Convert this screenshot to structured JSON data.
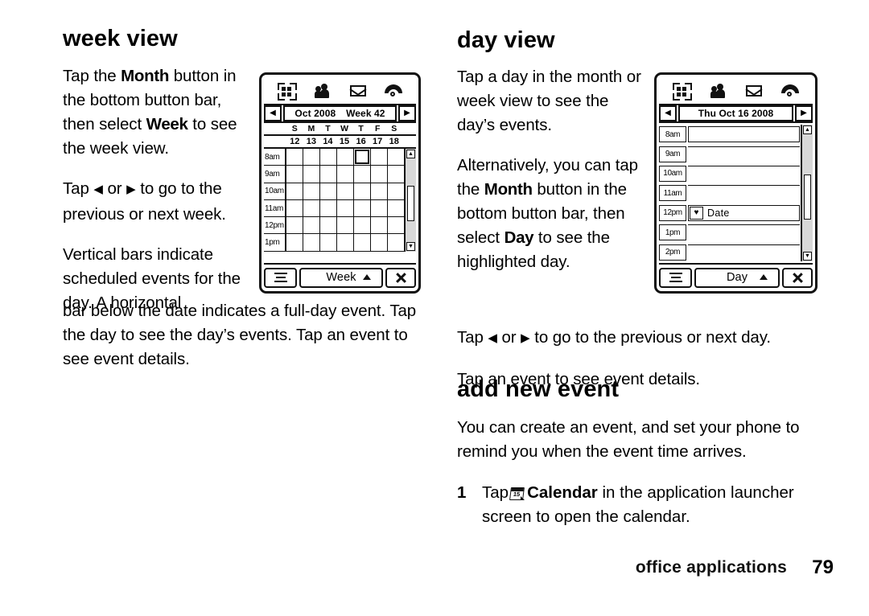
{
  "page": {
    "footer_section": "office applications",
    "page_number": "79"
  },
  "week_section": {
    "heading": "week view",
    "paragraphs": [
      "Tap the <b>Month</b> button in the bottom button bar, then select <b>Week</b> to see the week view.",
      "Tap ◀ or ▶ to go to the previous or next week.",
      "Vertical bars indicate scheduled events for the day. A horizontal"
    ],
    "wide_paragraph": "bar below the date indicates a full-day event. Tap the day to see the day’s events. Tap an event to see event details."
  },
  "day_section": {
    "heading": "day view",
    "paragraphs": [
      "Tap a day in the month or week view to see the day’s events.",
      "Alternatively, you can tap the <b>Month</b> button in the bottom button bar, then select <b>Day</b> to see the highlighted day."
    ],
    "lower_paragraphs": [
      "Tap ◀ or ▶ to go to the previous or next day.",
      "Tap an event to see event details."
    ]
  },
  "add_event_section": {
    "heading": "add new event",
    "intro": "You can create an event, and set your phone to remind you when the event time arrives.",
    "steps": [
      {
        "number": "1",
        "text_before": "Tap",
        "app_name": "Calendar",
        "icon_day": "15",
        "text_after": "in the application launcher screen to open the calendar."
      }
    ]
  },
  "week_phone": {
    "status_icons": [
      "launcher-icon",
      "contacts-icon",
      "message-icon",
      "call-icon"
    ],
    "nav": {
      "prev": "◀",
      "next": "▶",
      "month_year": "Oct 2008",
      "week_label": "Week 42"
    },
    "day_initials": [
      "S",
      "M",
      "T",
      "W",
      "T",
      "F",
      "S"
    ],
    "day_numbers": [
      "12",
      "13",
      "14",
      "15",
      "16",
      "17",
      "18"
    ],
    "time_labels": [
      "8am",
      "9am",
      "10am",
      "11am",
      "12pm",
      "1pm"
    ],
    "selected_cell": {
      "column_index": 4,
      "row_index": 0
    },
    "button_bar": {
      "menu": "menu-icon",
      "mode_label": "Week",
      "close": "close-icon"
    }
  },
  "day_phone": {
    "status_icons": [
      "launcher-icon",
      "contacts-icon",
      "message-icon",
      "call-icon"
    ],
    "nav": {
      "prev": "◀",
      "next": "▶",
      "title": "Thu Oct 16 2008"
    },
    "rows": [
      {
        "time": "8am",
        "event": "",
        "boxed": true
      },
      {
        "time": "9am",
        "event": ""
      },
      {
        "time": "10am",
        "event": ""
      },
      {
        "time": "11am",
        "event": ""
      },
      {
        "time": "12pm",
        "event": "Date",
        "icon": "♥"
      },
      {
        "time": "1pm",
        "event": ""
      },
      {
        "time": "2pm",
        "event": ""
      }
    ],
    "button_bar": {
      "menu": "menu-icon",
      "mode_label": "Day",
      "close": "close-icon"
    }
  }
}
